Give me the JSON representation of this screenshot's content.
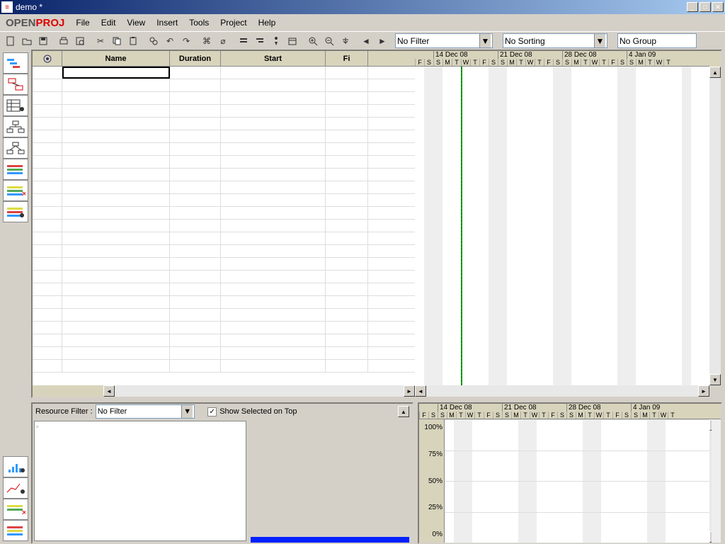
{
  "titlebar": {
    "text": "demo *"
  },
  "menu": {
    "items": [
      "File",
      "Edit",
      "View",
      "Insert",
      "Tools",
      "Project",
      "Help"
    ]
  },
  "toolbar": {
    "filter_label": "No Filter",
    "sorting_label": "No Sorting",
    "group_label": "No Group"
  },
  "grid": {
    "columns": [
      "",
      "Name",
      "Duration",
      "Start",
      "Fi"
    ],
    "widths": [
      42,
      152,
      72,
      148,
      60
    ]
  },
  "timeline": {
    "weeks": [
      "14 Dec 08",
      "21 Dec 08",
      "28 Dec 08",
      "4 Jan 09"
    ],
    "days_pre": [
      "F",
      "S"
    ],
    "days": [
      "S",
      "M",
      "T",
      "W",
      "T",
      "F",
      "S"
    ]
  },
  "resource_panel": {
    "filter_label": "Resource Filter :",
    "filter_value": "No Filter",
    "checkbox_label": "Show Selected on Top",
    "checked": true
  },
  "histogram": {
    "yaxis": [
      "100%",
      "75%",
      "50%",
      "25%",
      "0%"
    ]
  },
  "sidebar": {
    "top_count": 8,
    "bottom_count": 4
  }
}
